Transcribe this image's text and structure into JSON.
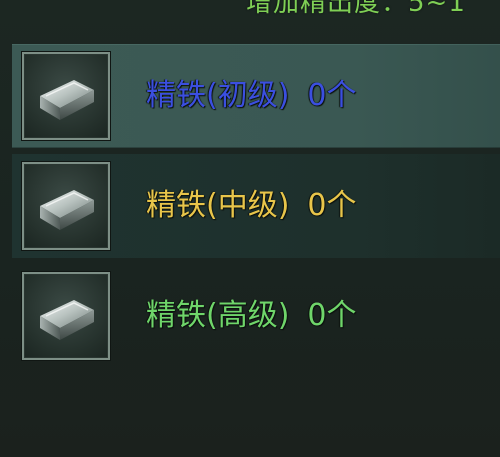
{
  "header": {
    "text": "增加精出度：5~1"
  },
  "items": [
    {
      "name": "精铁(初级)",
      "count": "0个",
      "color": "#3b4fe0",
      "selected": true,
      "icon": "iron-ingot-icon"
    },
    {
      "name": "精铁(中级)",
      "count": "0个",
      "color": "#e8c54a",
      "selected": false,
      "icon": "iron-ingot-icon"
    },
    {
      "name": "精铁(高级)",
      "count": "0个",
      "color": "#6fd56a",
      "selected": false,
      "icon": "iron-ingot-icon"
    }
  ]
}
